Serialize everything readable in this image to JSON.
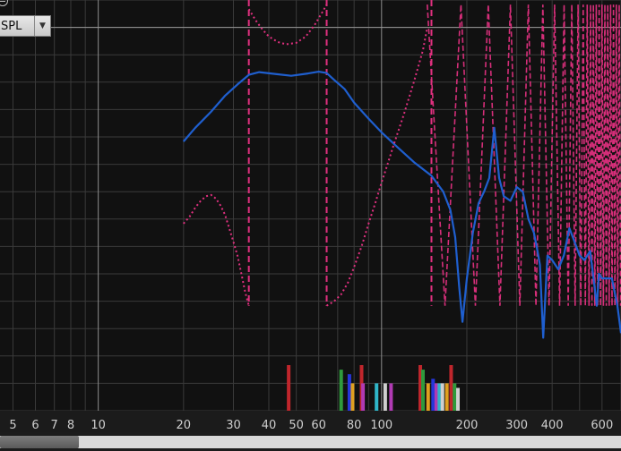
{
  "app": {
    "measurement_select": {
      "value": "SPL",
      "options": [
        "SPL"
      ]
    },
    "zoom_icon": "zoom-out-icon",
    "scrollbar": {
      "position_fraction": 0.0,
      "visible_fraction": 0.127
    }
  },
  "colors": {
    "background": "#111111",
    "grid_major": "#8c8c8c",
    "grid_minor": "#3a3a3a",
    "primary_trace": "#1f5fcf",
    "secondary_trace": "#e0307f"
  },
  "chart_data": {
    "type": "line",
    "title": "",
    "xlabel": "",
    "ylabel": "",
    "x_scale": "log",
    "xlim": [
      4.5,
      700
    ],
    "ylim": [
      -12,
      78
    ],
    "grid": true,
    "x_ticks": [
      5,
      6,
      7,
      8,
      10,
      20,
      30,
      40,
      50,
      60,
      80,
      100,
      200,
      300,
      400,
      600
    ],
    "x_tick_labels": [
      "5",
      "6",
      "7",
      "8",
      "10",
      "20",
      "30",
      "40",
      "50",
      "60",
      "80",
      "100",
      "200",
      "300",
      "400",
      "600"
    ],
    "series": [
      {
        "style": "solid",
        "color": "#1f5fcf",
        "x": [
          20,
          22,
          25,
          28,
          31,
          34,
          37,
          42,
          48,
          55,
          60,
          64,
          68,
          74,
          80,
          90,
          100,
          115,
          130,
          150,
          165,
          175,
          182,
          188,
          193,
          200,
          210,
          220,
          230,
          240,
          250,
          260,
          270,
          285,
          300,
          315,
          330,
          345,
          355,
          362,
          372,
          385,
          400,
          420,
          440,
          460,
          480,
          500,
          520,
          545,
          565,
          575,
          585,
          600,
          620,
          650,
          680,
          700
        ],
        "y": [
          47,
          50,
          53.5,
          57,
          59.5,
          61.6,
          62.2,
          61.8,
          61.4,
          61.9,
          62.3,
          62,
          60.5,
          58.5,
          55.5,
          52,
          49,
          45.5,
          42.5,
          39.5,
          36,
          32,
          26,
          15,
          7.5,
          17,
          27,
          33.5,
          36,
          39,
          50,
          39,
          35,
          34,
          37,
          36,
          30,
          27,
          23,
          20,
          4,
          22,
          21,
          19,
          22,
          28,
          25,
          22,
          21,
          23,
          15,
          11,
          18,
          17,
          17,
          17,
          11,
          5
        ]
      },
      {
        "style": "dotted",
        "color": "#e0307f",
        "x": [
          20,
          21,
          22,
          23,
          24,
          25,
          26,
          27,
          28,
          29,
          30,
          31,
          32,
          33,
          34
        ],
        "y": [
          29,
          30.5,
          32.5,
          34,
          35,
          35.3,
          34.5,
          33,
          31,
          28,
          25,
          22,
          18,
          14,
          11
        ]
      },
      {
        "style": "dotted",
        "color": "#e0307f",
        "x": [
          34,
          36,
          38,
          40,
          43,
          46,
          50,
          54,
          58,
          62,
          64
        ],
        "y": [
          76,
          73.5,
          71.5,
          70,
          68.8,
          68.3,
          68.6,
          70,
          72.5,
          75.5,
          77
        ]
      },
      {
        "style": "dotted",
        "color": "#e0307f",
        "x": [
          64,
          68,
          72,
          76,
          80,
          85,
          90,
          95,
          100,
          105,
          110,
          120,
          130,
          140,
          145
        ],
        "y": [
          11,
          12,
          13.5,
          16,
          19.5,
          24,
          29,
          33.5,
          38,
          42,
          46,
          53,
          60,
          67,
          72
        ]
      }
    ],
    "vertical_dashed_lines_x": [
      34,
      64,
      150
    ],
    "high_frequency_dense_band": {
      "from_x": 145,
      "to_x": 700,
      "y_range": [
        11,
        77
      ]
    },
    "bottom_markers": [
      {
        "x": 47,
        "height": 10,
        "color": "#c0262c"
      },
      {
        "x": 72,
        "height": 9,
        "color": "#2f9a3c"
      },
      {
        "x": 77,
        "height": 8,
        "color": "#2535d9"
      },
      {
        "x": 79,
        "height": 6,
        "color": "#e0a020"
      },
      {
        "x": 85,
        "height": 10,
        "color": "#c0262c"
      },
      {
        "x": 86,
        "height": 6,
        "color": "#b03ab3"
      },
      {
        "x": 96,
        "height": 6,
        "color": "#2fb5c8"
      },
      {
        "x": 103,
        "height": 6,
        "color": "#cfcfcf"
      },
      {
        "x": 108,
        "height": 6,
        "color": "#b03ab3"
      },
      {
        "x": 137,
        "height": 10,
        "color": "#c0262c"
      },
      {
        "x": 140,
        "height": 9,
        "color": "#2f9a3c"
      },
      {
        "x": 146,
        "height": 6,
        "color": "#e0a020"
      },
      {
        "x": 152,
        "height": 7,
        "color": "#2535d9"
      },
      {
        "x": 156,
        "height": 6,
        "color": "#b03ab3"
      },
      {
        "x": 160,
        "height": 6,
        "color": "#2fb5c8"
      },
      {
        "x": 164,
        "height": 6,
        "color": "#cfcfcf"
      },
      {
        "x": 170,
        "height": 6,
        "color": "#e0a020"
      },
      {
        "x": 176,
        "height": 10,
        "color": "#c0262c"
      },
      {
        "x": 181,
        "height": 6,
        "color": "#2f9a3c"
      },
      {
        "x": 186,
        "height": 5,
        "color": "#cfcfcf"
      }
    ]
  }
}
